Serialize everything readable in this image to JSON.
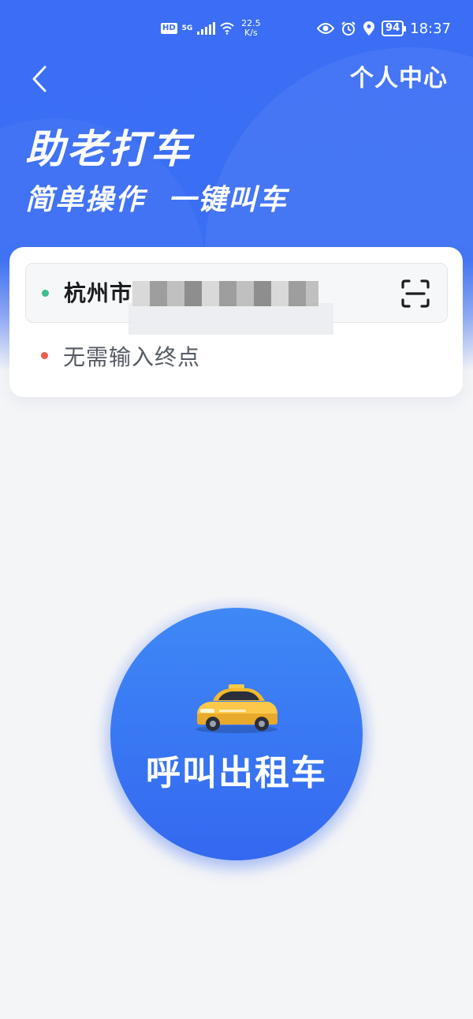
{
  "status_bar": {
    "hd": "HD",
    "network": "5G",
    "net_speed_value": "22.5",
    "net_speed_unit": "K/s",
    "battery": "94",
    "time": "18:37"
  },
  "nav": {
    "right_link": "个人中心"
  },
  "hero": {
    "title": "助老打车",
    "subtitle": "简单操作  一键叫车"
  },
  "address": {
    "start_text": "杭州市",
    "end_placeholder": "无需输入终点",
    "start_dot_color": "#3dbd8e",
    "end_dot_color": "#ee5a4c"
  },
  "call_button": {
    "label": "呼叫出租车"
  },
  "colors": {
    "primary": "#3b6ef5",
    "button_top": "#3f88f6",
    "button_bottom": "#3468f0"
  }
}
